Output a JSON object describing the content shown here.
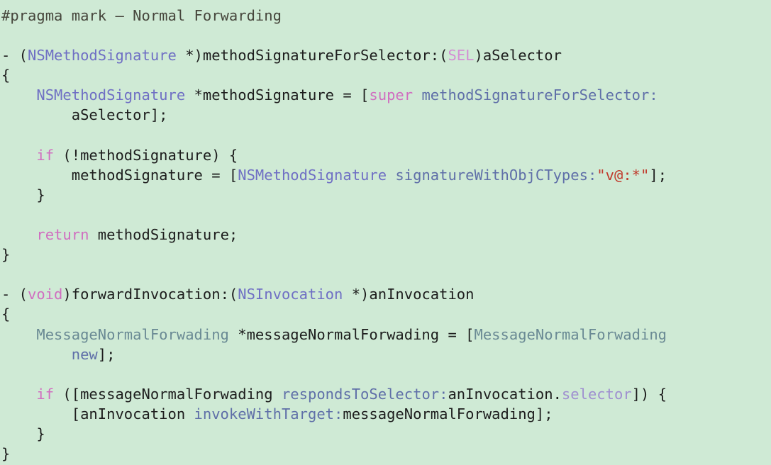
{
  "editor": {
    "language": "Objective-C",
    "background_color": "#cfead5",
    "default_text_color": "#1d1d1d",
    "font_size_px": 20.5,
    "line_height_px": 28.1,
    "palette": {
      "comment": "#46463c",
      "keyword": "#d06ec0",
      "class_name": "#6f6fc4",
      "builtin_type": "#d48fd4",
      "selector": "#5f6fa8",
      "user_type": "#6a8a94",
      "property": "#9f8fd0",
      "string": "#c0392b",
      "plain": "#1d1d1d"
    }
  },
  "code": {
    "lines": [
      {
        "index": 1,
        "text": "#pragma mark – Normal Forwarding",
        "tokens": [
          {
            "text": "#pragma mark – Normal Forwarding",
            "type": "comment"
          }
        ]
      },
      {
        "index": 2,
        "text": "",
        "tokens": []
      },
      {
        "index": 3,
        "text": "- (NSMethodSignature *)methodSignatureForSelector:(SEL)aSelector",
        "tokens": [
          {
            "text": "- (",
            "type": "plain"
          },
          {
            "text": "NSMethodSignature",
            "type": "class"
          },
          {
            "text": " *)methodSignatureForSelector:(",
            "type": "plain"
          },
          {
            "text": "SEL",
            "type": "type"
          },
          {
            "text": ")aSelector",
            "type": "plain"
          }
        ]
      },
      {
        "index": 4,
        "text": "{",
        "tokens": [
          {
            "text": "{",
            "type": "plain"
          }
        ]
      },
      {
        "index": 5,
        "text": "    NSMethodSignature *methodSignature = [super methodSignatureForSelector:",
        "tokens": [
          {
            "text": "    ",
            "type": "plain"
          },
          {
            "text": "NSMethodSignature",
            "type": "class"
          },
          {
            "text": " *methodSignature = [",
            "type": "plain"
          },
          {
            "text": "super",
            "type": "keyword"
          },
          {
            "text": " ",
            "type": "plain"
          },
          {
            "text": "methodSignatureForSelector:",
            "type": "selector"
          }
        ]
      },
      {
        "index": 6,
        "text": "        aSelector];",
        "tokens": [
          {
            "text": "        aSelector];",
            "type": "plain"
          }
        ]
      },
      {
        "index": 7,
        "text": "",
        "tokens": []
      },
      {
        "index": 8,
        "text": "    if (!methodSignature) {",
        "tokens": [
          {
            "text": "    ",
            "type": "plain"
          },
          {
            "text": "if",
            "type": "keyword"
          },
          {
            "text": " (!methodSignature) {",
            "type": "plain"
          }
        ]
      },
      {
        "index": 9,
        "text": "        methodSignature = [NSMethodSignature signatureWithObjCTypes:\"v@:*\"];",
        "tokens": [
          {
            "text": "        methodSignature = [",
            "type": "plain"
          },
          {
            "text": "NSMethodSignature",
            "type": "class"
          },
          {
            "text": " ",
            "type": "plain"
          },
          {
            "text": "signatureWithObjCTypes:",
            "type": "selector"
          },
          {
            "text": "\"v@:*\"",
            "type": "string"
          },
          {
            "text": "];",
            "type": "plain"
          }
        ]
      },
      {
        "index": 10,
        "text": "    }",
        "tokens": [
          {
            "text": "    }",
            "type": "plain"
          }
        ]
      },
      {
        "index": 11,
        "text": "",
        "tokens": []
      },
      {
        "index": 12,
        "text": "    return methodSignature;",
        "tokens": [
          {
            "text": "    ",
            "type": "plain"
          },
          {
            "text": "return",
            "type": "keyword"
          },
          {
            "text": " methodSignature;",
            "type": "plain"
          }
        ]
      },
      {
        "index": 13,
        "text": "}",
        "tokens": [
          {
            "text": "}",
            "type": "plain"
          }
        ]
      },
      {
        "index": 14,
        "text": "",
        "tokens": []
      },
      {
        "index": 15,
        "text": "- (void)forwardInvocation:(NSInvocation *)anInvocation",
        "tokens": [
          {
            "text": "- (",
            "type": "plain"
          },
          {
            "text": "void",
            "type": "keyword"
          },
          {
            "text": ")forwardInvocation:(",
            "type": "plain"
          },
          {
            "text": "NSInvocation",
            "type": "class"
          },
          {
            "text": " *)anInvocation",
            "type": "plain"
          }
        ]
      },
      {
        "index": 16,
        "text": "{",
        "tokens": [
          {
            "text": "{",
            "type": "plain"
          }
        ]
      },
      {
        "index": 17,
        "text": "    MessageNormalForwading *messageNormalForwading = [MessageNormalForwading",
        "tokens": [
          {
            "text": "    ",
            "type": "plain"
          },
          {
            "text": "MessageNormalForwading",
            "type": "usertype"
          },
          {
            "text": " *messageNormalForwading = [",
            "type": "plain"
          },
          {
            "text": "MessageNormalForwading",
            "type": "usertype"
          }
        ]
      },
      {
        "index": 18,
        "text": "        new];",
        "tokens": [
          {
            "text": "        ",
            "type": "plain"
          },
          {
            "text": "new",
            "type": "selector"
          },
          {
            "text": "];",
            "type": "plain"
          }
        ]
      },
      {
        "index": 19,
        "text": "",
        "tokens": []
      },
      {
        "index": 20,
        "text": "    if ([messageNormalForwading respondsToSelector:anInvocation.selector]) {",
        "tokens": [
          {
            "text": "    ",
            "type": "plain"
          },
          {
            "text": "if",
            "type": "keyword"
          },
          {
            "text": " ([messageNormalForwading ",
            "type": "plain"
          },
          {
            "text": "respondsToSelector:",
            "type": "selector"
          },
          {
            "text": "anInvocation.",
            "type": "plain"
          },
          {
            "text": "selector",
            "type": "property"
          },
          {
            "text": "]) {",
            "type": "plain"
          }
        ]
      },
      {
        "index": 21,
        "text": "        [anInvocation invokeWithTarget:messageNormalForwading];",
        "tokens": [
          {
            "text": "        [anInvocation ",
            "type": "plain"
          },
          {
            "text": "invokeWithTarget:",
            "type": "selector"
          },
          {
            "text": "messageNormalForwading];",
            "type": "plain"
          }
        ]
      },
      {
        "index": 22,
        "text": "    }",
        "tokens": [
          {
            "text": "    }",
            "type": "plain"
          }
        ]
      },
      {
        "index": 23,
        "text": "}",
        "tokens": [
          {
            "text": "}",
            "type": "plain"
          }
        ]
      }
    ]
  }
}
